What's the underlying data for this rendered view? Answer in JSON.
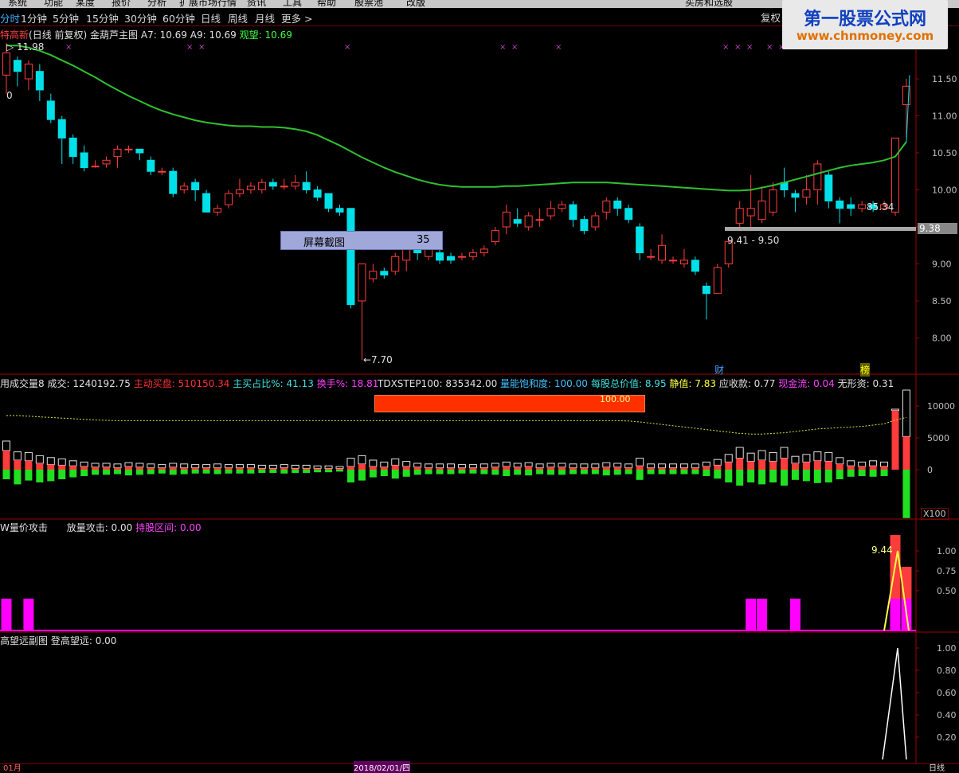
{
  "top_menu": [
    "系统",
    "功能",
    "某度",
    "报价",
    "分析",
    "扩展市场行情",
    "资讯",
    "工具",
    "帮助",
    "股票池",
    "改版",
    "买房和选股",
    "每"
  ],
  "periods": [
    {
      "label": "分时",
      "active": true
    },
    {
      "label": "1分钟"
    },
    {
      "label": "5分钟"
    },
    {
      "label": "15分钟"
    },
    {
      "label": "30分钟"
    },
    {
      "label": "60分钟"
    },
    {
      "label": "日线"
    },
    {
      "label": "周线"
    },
    {
      "label": "月线"
    },
    {
      "label": "更多 >"
    }
  ],
  "fuquan_label": "复权",
  "watermark": {
    "line1": "第一股票公式网",
    "line2": "www.chnmoney.com"
  },
  "main_chart": {
    "stock_name": "特高新",
    "mode": "(日线 前复权)",
    "indicator": "金葫芦主图",
    "a7": "A7: 10.69",
    "a9": "A9: 10.69",
    "guanwang": "观望: 10.69",
    "high_label": "11.98",
    "low_label": "←7.70",
    "last_label": "85.34",
    "zero_label": "0",
    "range_label": "9.41 - 9.50",
    "price_tag": "9.38",
    "cai_label": "财",
    "bang_label": "榜",
    "y_ticks": [
      "11.50",
      "11.00",
      "10.50",
      "10.00",
      "9.50",
      "9.00",
      "8.50",
      "8.00"
    ],
    "y_values": [
      11.5,
      11.0,
      10.5,
      10.0,
      9.5,
      9.0,
      8.5,
      8.0
    ]
  },
  "screenshot_box": {
    "label": "屏幕截图",
    "num": "35"
  },
  "volume_panel": {
    "title": "用成交量8",
    "chengjiao": "成交: 1240192.75",
    "zhudong": "主动买盘: 510150.34",
    "zhumai": "主买占比%: 41.13",
    "huanshou": "换手%: 18.81",
    "tdx": "TDXSTEP100: 835342.00",
    "liangneng": "量能饱和度: 100.00",
    "meigu": "每股总价值: 8.95",
    "jingzhi": "静值: 7.83",
    "yingshou": "应收款: 0.77",
    "xianjin": "现金流: 0.04",
    "wuxing": "无形资: 0.31",
    "bar_label": "100.00",
    "y_ticks": [
      "10000",
      "5000",
      "0"
    ],
    "unit": "X100"
  },
  "attack_panel": {
    "title": "W量价攻击",
    "fangliang": "放量攻击: 0.00",
    "chigu": "持股区间: 0.00",
    "peak_label": "9.44",
    "y_ticks": [
      "1.00",
      "0.75",
      "0.50"
    ]
  },
  "sub_panel": {
    "title": "高望远副图",
    "dengo": "登高望远: 0.00",
    "y_ticks": [
      "1.00",
      "0.80",
      "0.60",
      "0.40",
      "0.20"
    ]
  },
  "time_axis": {
    "left": "01月",
    "center": "2018/02/01/四",
    "right": "日线"
  },
  "colors": {
    "up": "#ff3c3c",
    "down": "#00e0e8",
    "ma": "#30c030",
    "vol_down": "#20e020",
    "magenta": "#ff00ff",
    "yellow": "#ffff40",
    "bg": "#000000"
  }
}
